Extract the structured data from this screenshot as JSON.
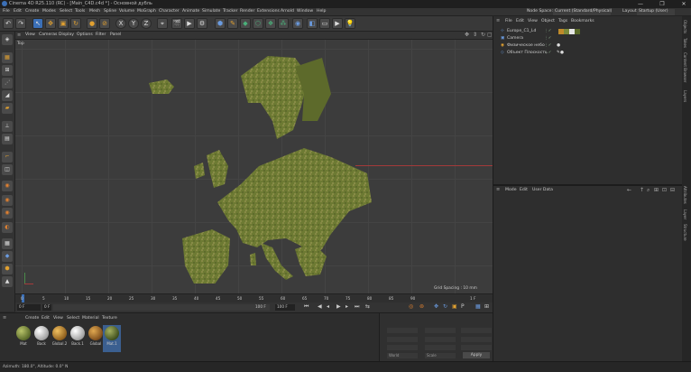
{
  "window": {
    "title": "Cinema 4D R25.110 (RC) - [Main_C4D.c4d *] - Основной дубль",
    "controls": [
      "—",
      "❐",
      "✕"
    ]
  },
  "menu": [
    "File",
    "Edit",
    "Create",
    "Modes",
    "Select",
    "Tools",
    "Mesh",
    "Spline",
    "Volume",
    "MoGraph",
    "Character",
    "Animate",
    "Simulate",
    "Tracker",
    "Render",
    "Extensions",
    "Arnold",
    "Window",
    "Help"
  ],
  "node_space": {
    "label": "Node Space:",
    "value": "Current (Standard/Physical)"
  },
  "layout": {
    "label": "Layout:",
    "value": "Startup (User)"
  },
  "toolbar": {
    "axis_x": "X",
    "axis_y": "Y",
    "axis_z": "Z"
  },
  "viewport": {
    "menu": [
      "View",
      "Cameras",
      "Display",
      "Options",
      "Filter",
      "Panel"
    ],
    "view_name": "Top",
    "grid_spacing": "Grid Spacing : 10 mm"
  },
  "timeline": {
    "ticks": [
      "0",
      "5",
      "10",
      "15",
      "20",
      "25",
      "30",
      "35",
      "40",
      "45",
      "50",
      "55",
      "60",
      "65",
      "70",
      "75",
      "80",
      "85",
      "90"
    ],
    "current_frame": "0 F",
    "start_field": "0 F",
    "end_field": "100 F",
    "end_field2": "100 F",
    "frame_right": "1 F"
  },
  "objects_panel": {
    "menu": [
      "File",
      "Edit",
      "View",
      "Object",
      "Tags",
      "Bookmarks"
    ],
    "items": [
      {
        "name": "Europe_C1_Ld"
      },
      {
        "name": "Camera"
      },
      {
        "name": "Физическое небо"
      },
      {
        "name": "Объект Плоскость"
      }
    ]
  },
  "attributes_panel": {
    "menu": [
      "Mode",
      "Edit",
      "User Data"
    ]
  },
  "materials_panel": {
    "menu": [
      "Create",
      "Edit",
      "View",
      "Select",
      "Material",
      "Texture"
    ],
    "materials": [
      {
        "label": "Mat",
        "color": "#7d8c3a"
      },
      {
        "label": "Back",
        "color": "#e6e6e6"
      },
      {
        "label": "Global.2",
        "color": "#c08a2a"
      },
      {
        "label": "Back.1",
        "color": "#e6e6e6"
      },
      {
        "label": "Global",
        "color": "#b0782a"
      },
      {
        "label": "Mat.1",
        "color": "#5a6a2a"
      }
    ]
  },
  "coords_panel": {
    "apply": "Apply",
    "mode_select": "World",
    "scale_select": "Scale"
  },
  "status": "Azimuth: 180.0°, Altitude: 0.0° N",
  "side_tabs": [
    "Objects",
    "Takes",
    "Content Browser",
    "Layers",
    "Attributes",
    "Layer",
    "Structure"
  ],
  "colors": {
    "land": "#6d7a33",
    "land_dark": "#3f4a1c",
    "sea": "#3c3c3c",
    "accent": "#3b6fb6",
    "axis_red": "#a33a3a"
  }
}
